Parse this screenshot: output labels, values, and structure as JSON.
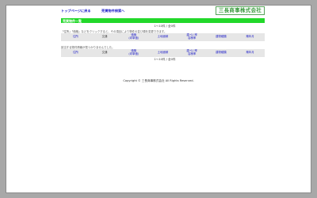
{
  "nav": {
    "top_link": "トップページに戻る",
    "search_link": "売買物件検索へ"
  },
  "logo_text": "三長商事株式会社",
  "section_title": "売買物件一覧",
  "results": {
    "count_top": "1～10件 / 全0件",
    "count_bottom": "1～10件 / 全0件"
  },
  "notes": {
    "sort_hint": "「住所」「価格」などをクリックすると、その項目により物件の並び順を変更できます。",
    "no_results": "該当する物件情報が見つかりませんでした。"
  },
  "sort_header": [
    {
      "label": "住所",
      "link": true
    },
    {
      "label": "交通",
      "link": false
    },
    {
      "label": "価格\n(坪単価)",
      "link": true
    },
    {
      "label": "土地面積",
      "link": true
    },
    {
      "label": "建ぺい率\n容積率",
      "link": true
    },
    {
      "label": "建物種類",
      "link": true
    },
    {
      "label": "築年月",
      "link": true
    }
  ],
  "footer": "Copyright © 三長商事株式会社 All Rights Reserved.",
  "colors": {
    "background": "#a8a8a8",
    "section_bar": "#22d82a",
    "link": "#1c1cc8",
    "logo": "#3a9a3e",
    "table_cell": "#e6e6e6"
  }
}
